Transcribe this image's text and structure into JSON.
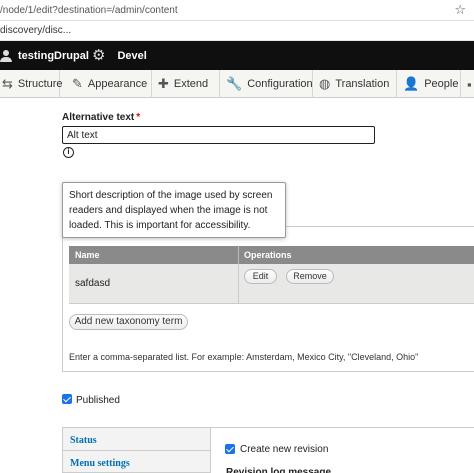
{
  "browser": {
    "url": "/node/1/edit?destination=/admin/content",
    "bookmark": "discovery/disc..."
  },
  "toolbar": {
    "user_label": "testingDrupal",
    "devel_label": "Devel"
  },
  "admin_menu": {
    "items": [
      {
        "label": "Structure",
        "icon": "structure-icon"
      },
      {
        "label": "Appearance",
        "icon": "appearance-icon"
      },
      {
        "label": "Extend",
        "icon": "extend-icon"
      },
      {
        "label": "Configuration",
        "icon": "configuration-icon"
      },
      {
        "label": "Translation",
        "icon": "globe-icon"
      },
      {
        "label": "People",
        "icon": "people-icon"
      }
    ]
  },
  "alt_text": {
    "label": "Alternative text",
    "required_mark": "*",
    "value": "Alt text",
    "tooltip": "Short description of the image used by screen readers and displayed when the image is not loaded. This is important for accessibility."
  },
  "terms_table": {
    "headers": [
      "Name",
      "Operations"
    ],
    "rows": [
      {
        "name": "safdasd",
        "edit_label": "Edit",
        "remove_label": "Remove"
      }
    ],
    "add_button": "Add new taxonomy term",
    "help": "Enter a comma-separated list. For example: Amsterdam, Mexico City, \"Cleveland, Ohio\""
  },
  "published": {
    "label": "Published",
    "checked": true
  },
  "vertical_tabs": {
    "items": [
      "Status",
      "Menu settings"
    ]
  },
  "revision": {
    "label": "Create new revision",
    "checked": true,
    "next_label": "Revision log message"
  },
  "colors": {
    "toolbar_bg": "#0f0f0f",
    "checkbox": "#1a73e8",
    "link": "#0070b3",
    "required": "#e00000"
  }
}
